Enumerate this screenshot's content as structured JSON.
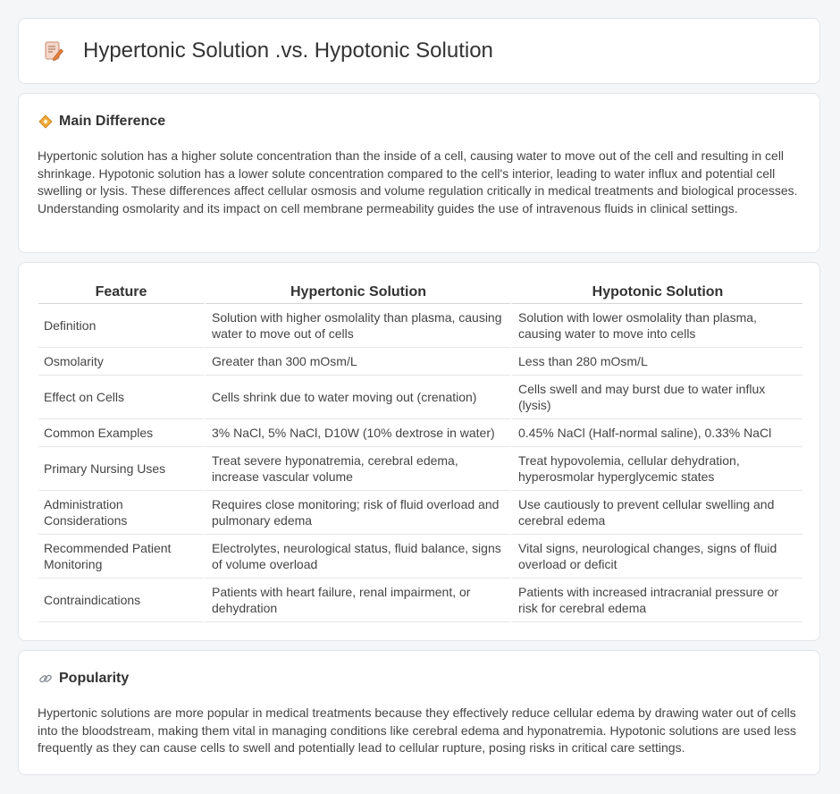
{
  "header": {
    "title": "Hypertonic Solution .vs. Hypotonic Solution",
    "icon": "document-edit-icon"
  },
  "main_difference": {
    "title": "Main Difference",
    "icon": "diamond-icon",
    "text": "Hypertonic solution has a higher solute concentration than the inside of a cell, causing water to move out of the cell and resulting in cell shrinkage. Hypotonic solution has a lower solute concentration compared to the cell's interior, leading to water influx and potential cell swelling or lysis. These differences affect cellular osmosis and volume regulation critically in medical treatments and biological processes. Understanding osmolarity and its impact on cell membrane permeability guides the use of intravenous fluids in clinical settings."
  },
  "table": {
    "headers": [
      "Feature",
      "Hypertonic Solution",
      "Hypotonic Solution"
    ],
    "rows": [
      [
        "Definition",
        "Solution with higher osmolality than plasma, causing water to move out of cells",
        "Solution with lower osmolality than plasma, causing water to move into cells"
      ],
      [
        "Osmolarity",
        "Greater than 300 mOsm/L",
        "Less than 280 mOsm/L"
      ],
      [
        "Effect on Cells",
        "Cells shrink due to water moving out (crenation)",
        "Cells swell and may burst due to water influx (lysis)"
      ],
      [
        "Common Examples",
        "3% NaCl, 5% NaCl, D10W (10% dextrose in water)",
        "0.45% NaCl (Half-normal saline), 0.33% NaCl"
      ],
      [
        "Primary Nursing Uses",
        "Treat severe hyponatremia, cerebral edema, increase vascular volume",
        "Treat hypovolemia, cellular dehydration, hyperosmolar hyperglycemic states"
      ],
      [
        "Administration Considerations",
        "Requires close monitoring; risk of fluid overload and pulmonary edema",
        "Use cautiously to prevent cellular swelling and cerebral edema"
      ],
      [
        "Recommended Patient Monitoring",
        "Electrolytes, neurological status, fluid balance, signs of volume overload",
        "Vital signs, neurological changes, signs of fluid overload or deficit"
      ],
      [
        "Contraindications",
        "Patients with heart failure, renal impairment, or dehydration",
        "Patients with increased intracranial pressure or risk for cerebral edema"
      ]
    ]
  },
  "popularity": {
    "title": "Popularity",
    "icon": "link-icon",
    "text": "Hypertonic solutions are more popular in medical treatments because they effectively reduce cellular edema by drawing water out of cells into the bloodstream, making them vital in managing conditions like cerebral edema and hyponatremia. Hypotonic solutions are used less frequently as they can cause cells to swell and potentially lead to cellular rupture, posing risks in critical care settings."
  }
}
